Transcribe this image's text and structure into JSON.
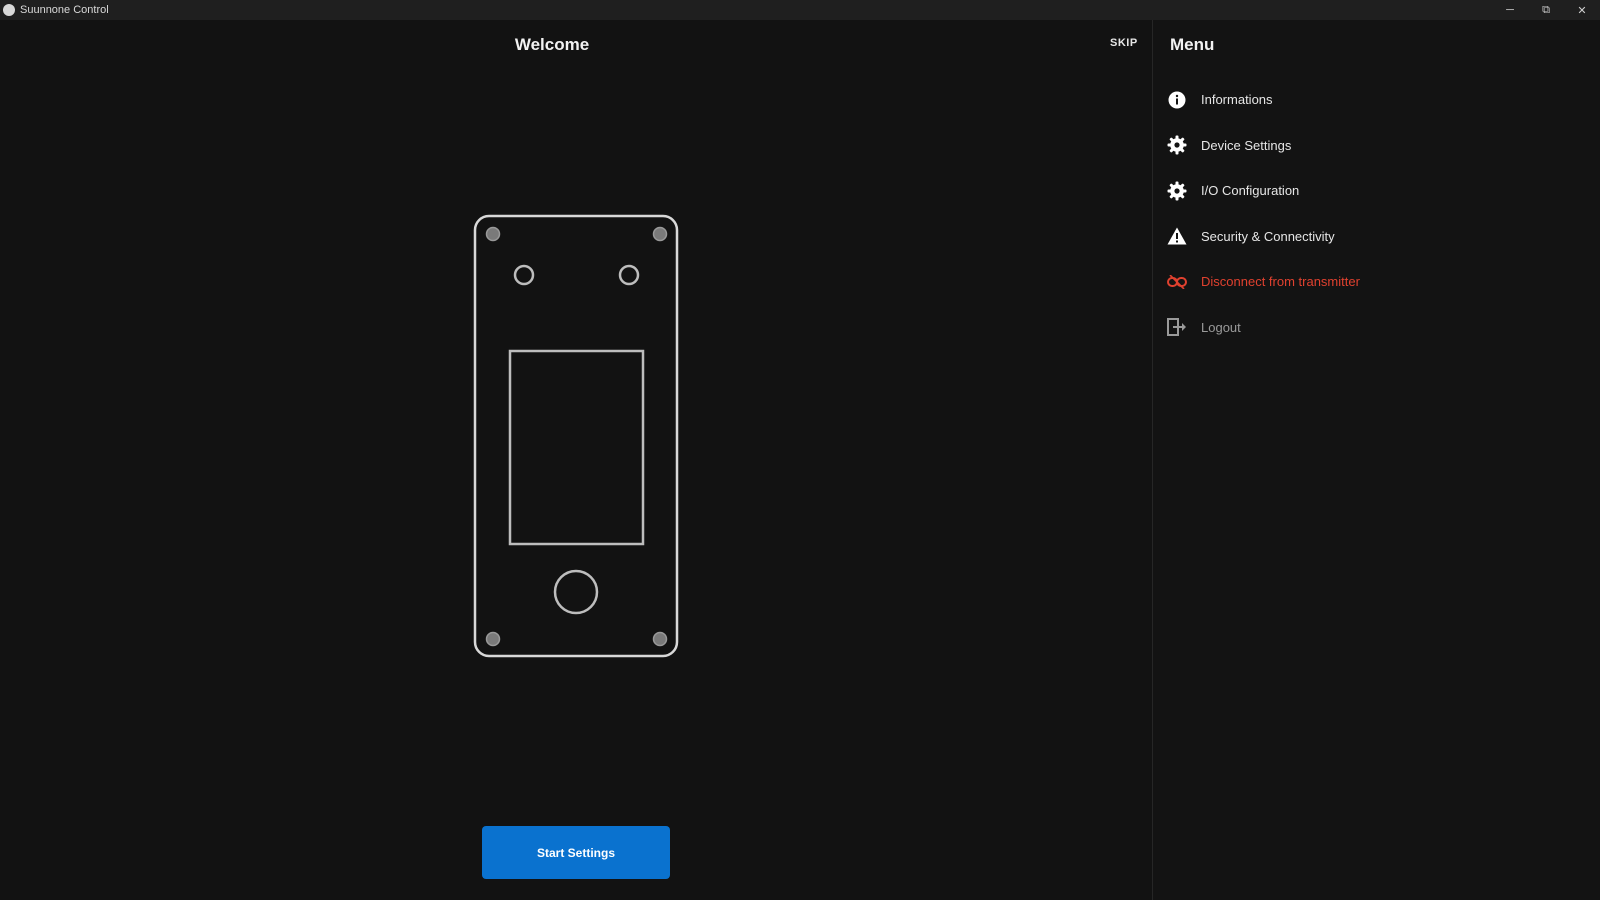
{
  "window": {
    "title": "Suunnone Control",
    "controls": {
      "minimize": "─",
      "restore": "⧉",
      "close": "✕"
    }
  },
  "main": {
    "title": "Welcome",
    "skip_label": "SKIP",
    "start_button_label": "Start Settings"
  },
  "sidebar": {
    "title": "Menu",
    "items": [
      {
        "label": "Informations",
        "icon": "info-icon"
      },
      {
        "label": "Device Settings",
        "icon": "gear-icon"
      },
      {
        "label": "I/O Configuration",
        "icon": "gear-icon"
      },
      {
        "label": "Security & Connectivity",
        "icon": "warning-icon"
      },
      {
        "label": "Disconnect from transmitter",
        "icon": "disconnect-link-icon"
      },
      {
        "label": "Logout",
        "icon": "logout-icon"
      }
    ]
  },
  "colors": {
    "accent": "#0a72cf",
    "danger": "#e0412f",
    "background": "#121212"
  }
}
